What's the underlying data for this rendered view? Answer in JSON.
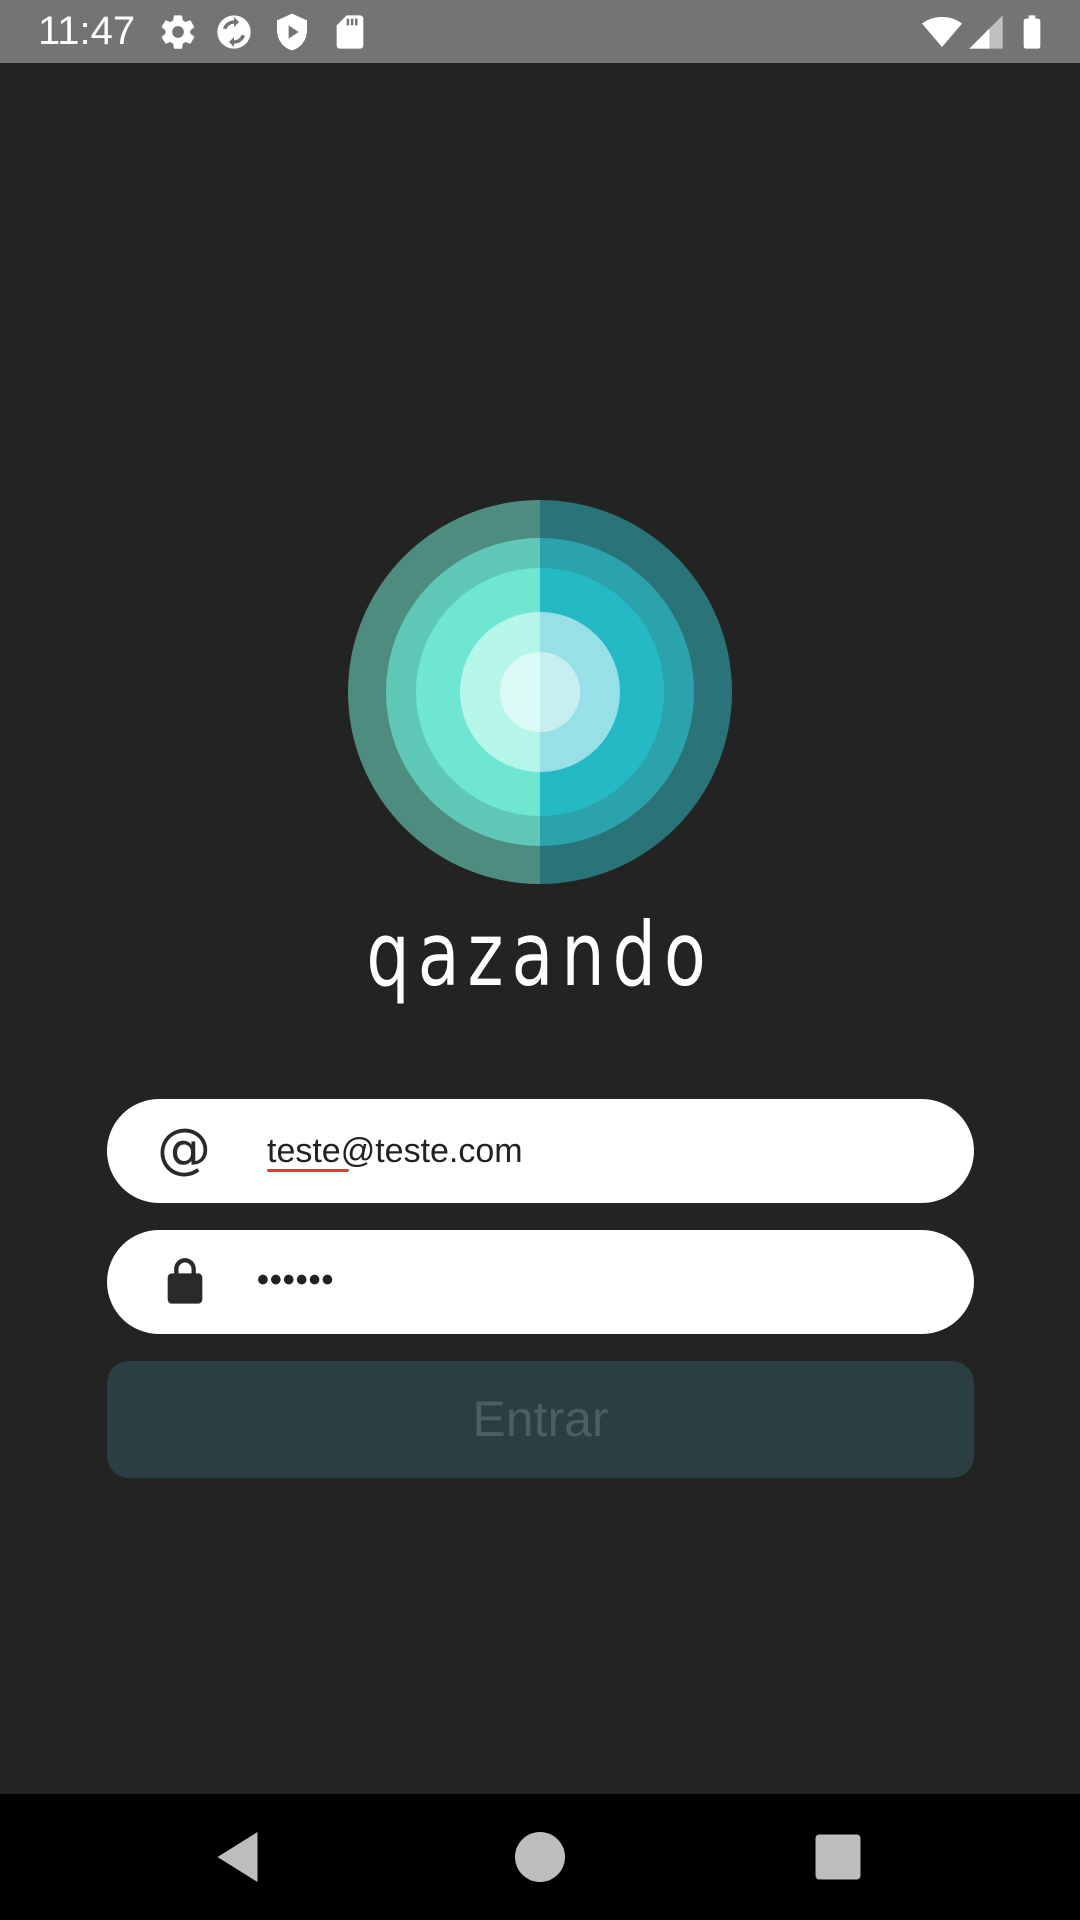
{
  "status_bar": {
    "time": "11:47",
    "left_icons": [
      "gear-icon",
      "sync-icon",
      "shield-icon",
      "sd-card-icon"
    ],
    "right_icons": [
      "wifi-icon",
      "signal-icon",
      "battery-icon"
    ]
  },
  "logo": {
    "name": "qazando",
    "colors": {
      "left_ring_1": "#4e8c80",
      "left_ring_2": "#5fc7b5",
      "left_ring_3": "#6ee6d2",
      "left_ring_4": "#b6f5ea",
      "left_core": "#dcfaf5",
      "right_ring_1": "#2a7378",
      "right_ring_2": "#2aa3ad",
      "right_ring_3": "#25b9c6",
      "right_ring_4": "#97e0e7",
      "right_core": "#c8efef"
    }
  },
  "form": {
    "email": {
      "icon": "at-icon",
      "value": "teste@teste.com"
    },
    "password": {
      "icon": "lock-icon",
      "value": "••••••"
    },
    "submit_label": "Entrar"
  },
  "nav_bar": {
    "buttons": [
      "back-icon",
      "home-icon",
      "recents-icon"
    ]
  }
}
